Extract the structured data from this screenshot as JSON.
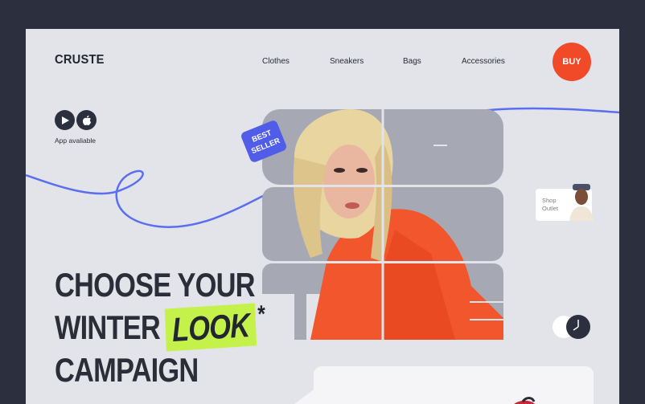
{
  "brand": "CRUSTE",
  "nav": [
    "Clothes",
    "Sneakers",
    "Bags",
    "Accessories"
  ],
  "buy_label": "BUY",
  "app_label": "App avaliable",
  "badge": {
    "line1": "BEST",
    "line2": "SELLER"
  },
  "shop_outlet": {
    "line1": "Shop",
    "line2": "Outlet"
  },
  "headline": {
    "line1": "CHOOSE YOUR",
    "line2_prefix": "WINTER",
    "highlight": "LOOK",
    "asterisk": "*",
    "line3": "CAMPAIGN"
  },
  "colors": {
    "accent_red": "#f04a29",
    "accent_blue": "#4f5de8",
    "accent_lime": "#c4f14a",
    "dark": "#2c303e"
  },
  "icons": [
    "play-store-icon",
    "apple-icon",
    "clock-toggle-icon"
  ]
}
